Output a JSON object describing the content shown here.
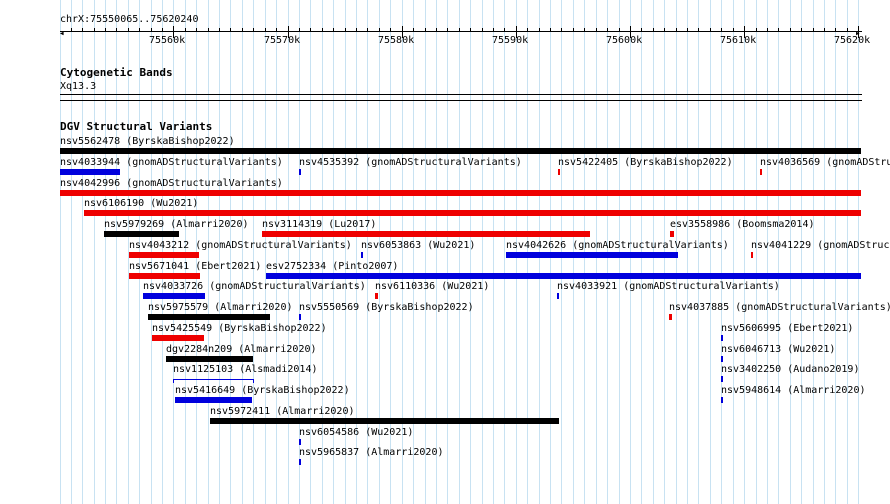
{
  "ruler": {
    "region": "chrX:75550065..75620240",
    "start": 75550065,
    "end": 75620240,
    "ticks": [
      {
        "pos": 75560000,
        "label": "75560k"
      },
      {
        "pos": 75570000,
        "label": "75570k"
      },
      {
        "pos": 75580000,
        "label": "75580k"
      },
      {
        "pos": 75590000,
        "label": "75590k"
      },
      {
        "pos": 75600000,
        "label": "75600k"
      },
      {
        "pos": 75610000,
        "label": "75610k"
      },
      {
        "pos": 75620000,
        "label": "75620k"
      }
    ]
  },
  "cytoband": {
    "title": "Cytogenetic Bands",
    "band": "Xq13.3"
  },
  "dgv": {
    "title": "DGV Structural Variants",
    "colors": {
      "black": "#000000",
      "red": "#ee0000",
      "blue": "#0000dd"
    },
    "variants": [
      {
        "id": "nsv5562478",
        "source": "ByrskaBishop2022",
        "start": 75550065,
        "end": 75620240,
        "color": "black",
        "row": 0
      },
      {
        "id": "nsv4033944",
        "source": "gnomADStructuralVariants",
        "start": 75550065,
        "end": 75555300,
        "color": "blue",
        "row": 1
      },
      {
        "id": "nsv4535392",
        "source": "gnomADStructuralVariants",
        "start": 75571000,
        "end": 75571150,
        "color": "blue",
        "row": 1
      },
      {
        "id": "nsv5422405",
        "source": "ByrskaBishop2022",
        "start": 75593680,
        "end": 75593900,
        "color": "red",
        "row": 1
      },
      {
        "id": "nsv4036569",
        "source": "gnomADStructuralVariants",
        "start": 75611350,
        "end": 75611550,
        "color": "red",
        "row": 1
      },
      {
        "id": "nsv4042996",
        "source": "gnomADStructuralVariants",
        "start": 75550065,
        "end": 75620240,
        "color": "red",
        "row": 2
      },
      {
        "id": "nsv6106190",
        "source": "Wu2021",
        "start": 75552200,
        "end": 75620240,
        "color": "red",
        "row": 3
      },
      {
        "id": "nsv5979269",
        "source": "Almarri2020",
        "start": 75553900,
        "end": 75560500,
        "color": "black",
        "row": 4
      },
      {
        "id": "nsv3114319",
        "source": "Lu2017",
        "start": 75567800,
        "end": 75596500,
        "color": "red",
        "row": 4
      },
      {
        "id": "esv3558986",
        "source": "Boomsma2014",
        "start": 75603500,
        "end": 75603900,
        "color": "red",
        "row": 4
      },
      {
        "id": "nsv4043212",
        "source": "gnomADStructuralVariants",
        "start": 75556100,
        "end": 75562200,
        "color": "red",
        "row": 5
      },
      {
        "id": "nsv6053863",
        "source": "Wu2021",
        "start": 75576450,
        "end": 75576600,
        "color": "blue",
        "row": 5
      },
      {
        "id": "nsv4042626",
        "source": "gnomADStructuralVariants",
        "start": 75589100,
        "end": 75604200,
        "color": "blue",
        "row": 5
      },
      {
        "id": "nsv4041229",
        "source": "gnomADStructuralVariants",
        "start": 75610600,
        "end": 75610800,
        "color": "red",
        "row": 5
      },
      {
        "id": "nsv5671041",
        "source": "Ebert2021",
        "start": 75556100,
        "end": 75562300,
        "color": "red",
        "row": 6
      },
      {
        "id": "esv2752334",
        "source": "Pinto2007",
        "start": 75568100,
        "end": 75620240,
        "color": "blue",
        "row": 6
      },
      {
        "id": "nsv4033726",
        "source": "gnomADStructuralVariants",
        "start": 75557300,
        "end": 75562800,
        "color": "blue",
        "row": 7
      },
      {
        "id": "nsv6110336",
        "source": "Wu2021",
        "start": 75577650,
        "end": 75577950,
        "color": "red",
        "row": 7
      },
      {
        "id": "nsv4033921",
        "source": "gnomADStructuralVariants",
        "start": 75593600,
        "end": 75593750,
        "color": "blue",
        "row": 7
      },
      {
        "id": "nsv5975579",
        "source": "Almarri2020",
        "start": 75557750,
        "end": 75568500,
        "color": "black",
        "row": 8
      },
      {
        "id": "nsv5550569",
        "source": "ByrskaBishop2022",
        "start": 75571000,
        "end": 75571150,
        "color": "blue",
        "row": 8
      },
      {
        "id": "nsv4037885",
        "source": "gnomADStructuralVariants",
        "start": 75603450,
        "end": 75603700,
        "color": "red",
        "row": 8
      },
      {
        "id": "nsv5425549",
        "source": "ByrskaBishop2022",
        "start": 75558100,
        "end": 75562700,
        "color": "red",
        "row": 9
      },
      {
        "id": "nsv5606995",
        "source": "Ebert2021",
        "start": 75607980,
        "end": 75608120,
        "color": "blue",
        "row": 9
      },
      {
        "id": "dgv2284n209",
        "source": "Almarri2020",
        "start": 75559350,
        "end": 75567000,
        "color": "black",
        "row": 10
      },
      {
        "id": "nsv6046713",
        "source": "Wu2021",
        "start": 75607980,
        "end": 75608120,
        "color": "blue",
        "row": 10
      },
      {
        "id": "nsv1125103",
        "source": "Alsmadi2014",
        "start": 75560000,
        "end": 75566900,
        "color": "blue",
        "row": 11,
        "style": "line"
      },
      {
        "id": "nsv3402250",
        "source": "Audano2019",
        "start": 75607980,
        "end": 75608120,
        "color": "blue",
        "row": 11
      },
      {
        "id": "nsv5416649",
        "source": "ByrskaBishop2022",
        "start": 75560100,
        "end": 75566900,
        "color": "blue",
        "row": 12
      },
      {
        "id": "nsv5948614",
        "source": "Almarri2020",
        "start": 75607980,
        "end": 75608120,
        "color": "blue",
        "row": 12
      },
      {
        "id": "nsv5972411",
        "source": "Almarri2020",
        "start": 75563200,
        "end": 75593750,
        "color": "black",
        "row": 13
      },
      {
        "id": "nsv6054586",
        "source": "Wu2021",
        "start": 75571000,
        "end": 75571150,
        "color": "blue",
        "row": 14
      },
      {
        "id": "nsv5965837",
        "source": "Almarri2020",
        "start": 75571000,
        "end": 75571150,
        "color": "blue",
        "row": 15
      }
    ]
  }
}
